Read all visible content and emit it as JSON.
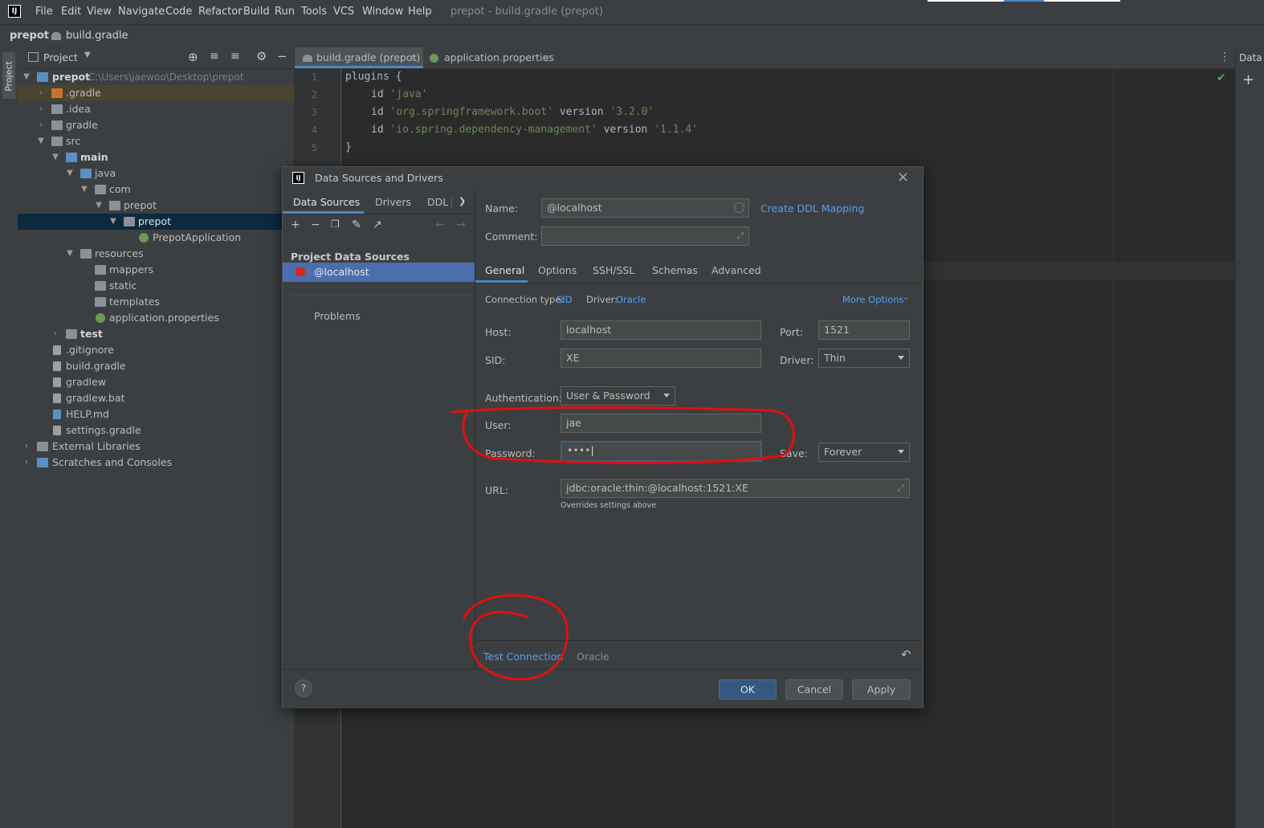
{
  "menubar": {
    "items": [
      "File",
      "Edit",
      "View",
      "Navigate",
      "Code",
      "Refactor",
      "Build",
      "Run",
      "Tools",
      "VCS",
      "Window",
      "Help"
    ],
    "title": "prepot - build.gradle (prepot)"
  },
  "breadcrumb": {
    "project": "prepot",
    "file": "build.gradle"
  },
  "left_strip": {
    "tab": "Project"
  },
  "project_panel": {
    "title": "Project",
    "tree": [
      {
        "label": "prepot",
        "path": "C:\\Users\\jaewoo\\Desktop\\prepot"
      },
      {
        "label": ".gradle"
      },
      {
        "label": ".idea"
      },
      {
        "label": "gradle"
      },
      {
        "label": "src"
      },
      {
        "label": "main"
      },
      {
        "label": "java"
      },
      {
        "label": "com"
      },
      {
        "label": "prepot"
      },
      {
        "label": "prepot"
      },
      {
        "label": "PrepotApplication"
      },
      {
        "label": "resources"
      },
      {
        "label": "mappers"
      },
      {
        "label": "static"
      },
      {
        "label": "templates"
      },
      {
        "label": "application.properties"
      },
      {
        "label": "test"
      },
      {
        "label": ".gitignore"
      },
      {
        "label": "build.gradle"
      },
      {
        "label": "gradlew"
      },
      {
        "label": "gradlew.bat"
      },
      {
        "label": "HELP.md"
      },
      {
        "label": "settings.gradle"
      },
      {
        "label": "External Libraries"
      },
      {
        "label": "Scratches and Consoles"
      }
    ]
  },
  "editor": {
    "tabs": [
      {
        "label": "build.gradle (prepot)",
        "close": "×"
      },
      {
        "label": "application.properties",
        "close": "×"
      }
    ],
    "lines": [
      "1",
      "2",
      "3",
      "4",
      "5"
    ],
    "code": {
      "l1": "plugins {",
      "l2_kw": "id ",
      "l2_str": "'java'",
      "l3_kw": "id ",
      "l3_str": "'org.springframework.boot'",
      "l3_mid": " version ",
      "l3_str2": "'3.2.0'",
      "l4_kw": "id ",
      "l4_str": "'io.spring.dependency-management'",
      "l4_mid": " version ",
      "l4_str2": "'1.1.4'",
      "l5": "}"
    }
  },
  "right_strip": {
    "label": "Data"
  },
  "dialog": {
    "title": "Data Sources and Drivers",
    "left_tabs": [
      "Data Sources",
      "Drivers",
      "DDL"
    ],
    "section": "Project Data Sources",
    "datasource": "@localhost",
    "problems": "Problems",
    "name_label": "Name:",
    "name_value": "@localhost",
    "comment_label": "Comment:",
    "create_ddl": "Create DDL Mapping",
    "tabs": [
      "General",
      "Options",
      "SSH/SSL",
      "Schemas",
      "Advanced"
    ],
    "conn_type_label": "Connection type:",
    "conn_type": "SID",
    "driver_label": "Driver:",
    "driver": "Oracle",
    "more_options": "More Options",
    "host_label": "Host:",
    "host": "localhost",
    "port_label": "Port:",
    "port": "1521",
    "sid_label": "SID:",
    "sid": "XE",
    "driver2_label": "Driver:",
    "driver2": "Thin",
    "auth_label": "Authentication:",
    "auth": "User & Password",
    "user_label": "User:",
    "user": "jae",
    "password_label": "Password:",
    "password": "••••",
    "save_label": "Save:",
    "save": "Forever",
    "url_label": "URL:",
    "url": "jdbc:oracle:thin:@localhost:1521:XE",
    "url_hint": "Overrides settings above",
    "test_connection": "Test Connection",
    "footer_driver": "Oracle",
    "help": "?",
    "ok": "OK",
    "cancel": "Cancel",
    "apply": "Apply"
  },
  "colors": {
    "accent": "#4a88c7",
    "link": "#589df6",
    "annotation": "#e01010"
  }
}
